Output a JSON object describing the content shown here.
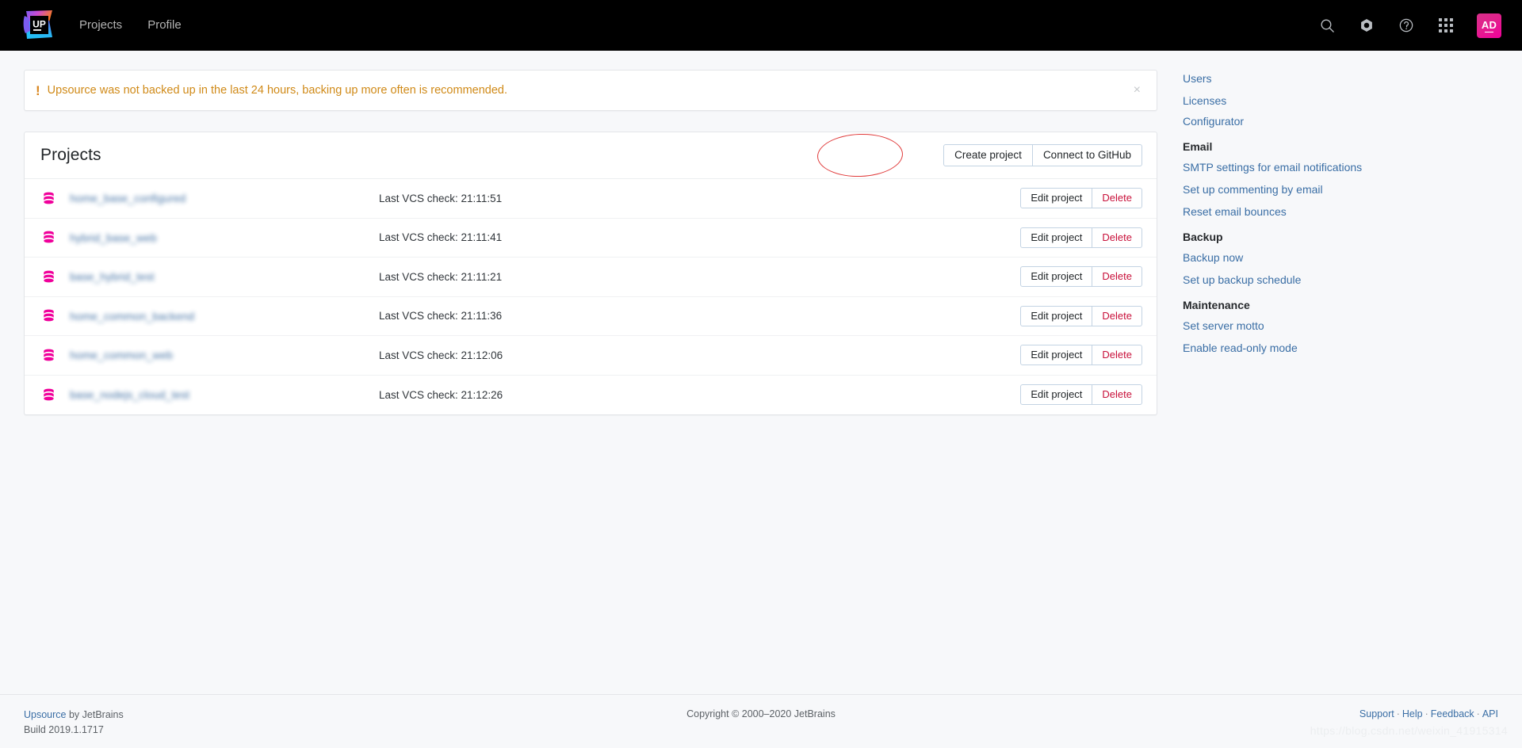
{
  "topbar": {
    "logo_name": "upsource-logo",
    "logo_text": "UP",
    "nav": [
      {
        "label": "Projects",
        "name": "nav-projects"
      },
      {
        "label": "Profile",
        "name": "nav-profile"
      }
    ],
    "icons": [
      {
        "name": "search-icon",
        "glyph": "search"
      },
      {
        "name": "settings-icon",
        "glyph": "nut"
      },
      {
        "name": "help-icon",
        "glyph": "question-circle"
      },
      {
        "name": "apps-grid-icon",
        "glyph": "grid"
      }
    ],
    "avatar": {
      "initials": "AD",
      "color": "#e2218c"
    }
  },
  "banner": {
    "icon": "!",
    "text": "Upsource was not backed up in the last 24 hours, backing up more often is recommended.",
    "close": "×",
    "text_color": "#d08a18"
  },
  "projects_card": {
    "title": "Projects",
    "create_button": "Create project",
    "github_button": "Connect to GitHub",
    "annotation_color": "#e03b3b",
    "row_action_edit": "Edit project",
    "row_action_delete": "Delete",
    "vcs_prefix": "Last VCS check:",
    "rows": [
      {
        "name": "home_base_configured",
        "vcs": "Last VCS check: 21:11:51"
      },
      {
        "name": "hybrid_base_web",
        "vcs": "Last VCS check: 21:11:41"
      },
      {
        "name": "base_hybrid_test",
        "vcs": "Last VCS check: 21:11:21"
      },
      {
        "name": "home_common_backend",
        "vcs": "Last VCS check: 21:11:36"
      },
      {
        "name": "home_common_web",
        "vcs": "Last VCS check: 21:12:06"
      },
      {
        "name": "base_nodejs_cloud_test",
        "vcs": "Last VCS check: 21:12:26"
      }
    ]
  },
  "sidebar": {
    "top_links": [
      {
        "label": "Users",
        "name": "sidebar-link-users"
      },
      {
        "label": "Licenses",
        "name": "sidebar-link-licenses"
      },
      {
        "label": "Configurator",
        "name": "sidebar-link-configurator"
      }
    ],
    "sections": [
      {
        "heading": "Email",
        "links": [
          {
            "label": "SMTP settings for email notifications",
            "name": "sidebar-link-smtp-settings"
          },
          {
            "label": "Set up commenting by email",
            "name": "sidebar-link-commenting-by-email"
          },
          {
            "label": "Reset email bounces",
            "name": "sidebar-link-reset-email-bounces"
          }
        ]
      },
      {
        "heading": "Backup",
        "links": [
          {
            "label": "Backup now",
            "name": "sidebar-link-backup-now"
          },
          {
            "label": "Set up backup schedule",
            "name": "sidebar-link-backup-schedule"
          }
        ]
      },
      {
        "heading": "Maintenance",
        "links": [
          {
            "label": "Set server motto",
            "name": "sidebar-link-server-motto"
          },
          {
            "label": "Enable read-only mode",
            "name": "sidebar-link-read-only-mode"
          }
        ]
      }
    ]
  },
  "footer": {
    "product_link": "Upsource",
    "product_suffix": " by JetBrains",
    "build": "Build 2019.1.1717",
    "copyright": "Copyright © 2000–2020 JetBrains",
    "links": [
      "Support",
      "Help",
      "Feedback",
      "API"
    ],
    "separator": "·"
  },
  "watermark": "https://blog.csdn.net/weixin_41915314"
}
